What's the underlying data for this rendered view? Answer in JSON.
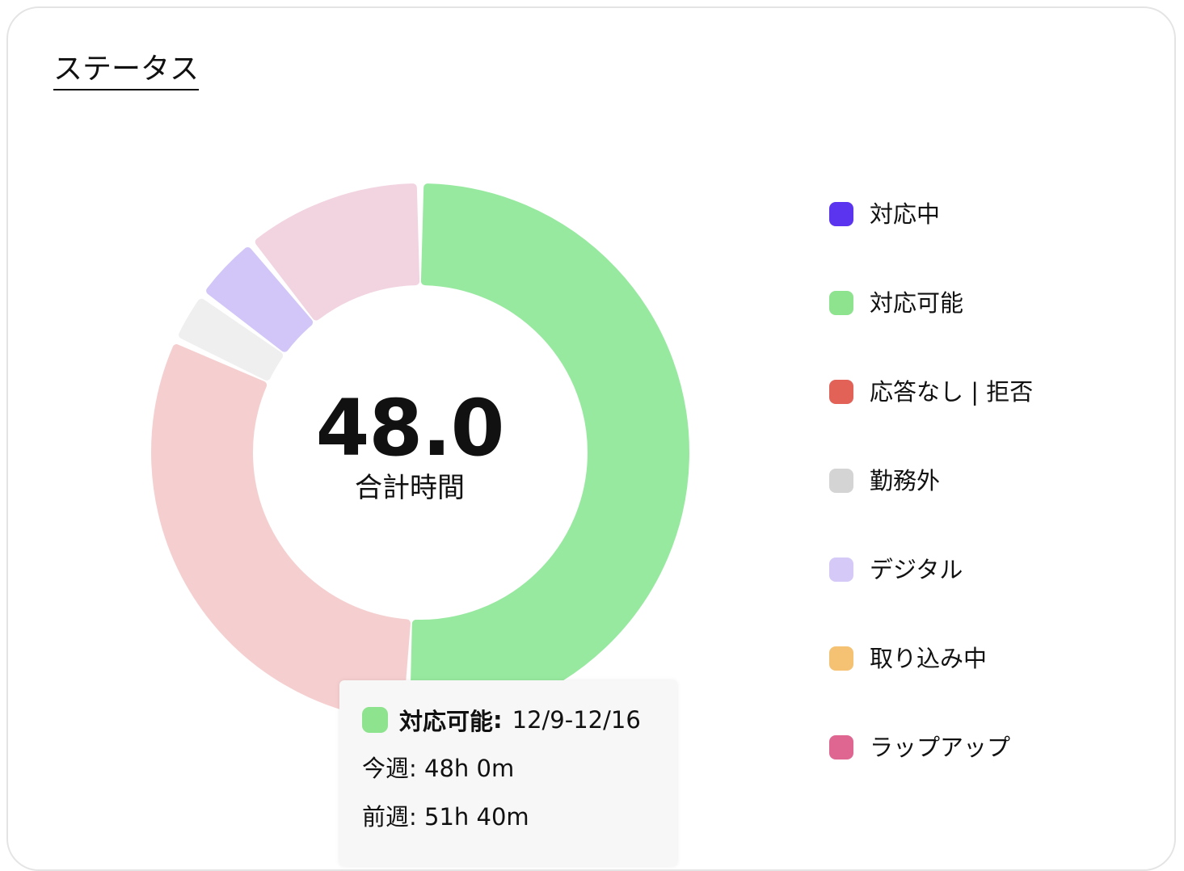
{
  "card": {
    "title": "ステータス"
  },
  "chart_data": {
    "type": "pie",
    "variant": "donut",
    "center": {
      "value": "48.0",
      "label": "合計時間"
    },
    "series": [
      {
        "name": "対応中",
        "value": 0,
        "color": "#5b34f0",
        "display_color": "#5b34f0"
      },
      {
        "name": "対応可能",
        "value": 24.4,
        "color": "#8ee38e",
        "display_color": "#97e99f"
      },
      {
        "name": "応答なし | 拒否",
        "value": 14.9,
        "color": "#e26258",
        "display_color": "#f5cfcf"
      },
      {
        "name": "勤務外",
        "value": 1.5,
        "color": "#d4d4d4",
        "display_color": "#efefef"
      },
      {
        "name": "デジタル",
        "value": 2.0,
        "color": "#d5c9f8",
        "display_color": "#d2c6f8"
      },
      {
        "name": "取り込み中",
        "value": 0,
        "color": "#f4c272",
        "display_color": "#f4c272"
      },
      {
        "name": "ラップアップ",
        "value": 5.2,
        "color": "#de6691",
        "display_color": "#f2d3e0"
      }
    ],
    "legend_position": "right",
    "highlighted": "対応可能"
  },
  "tooltip": {
    "series": "対応可能",
    "colon": ":",
    "range": "12/9-12/16",
    "this_week_label": "今週:",
    "this_week_value": "48h 0m",
    "last_week_label": "前週:",
    "last_week_value": "51h 40m",
    "color": "#8ee38e"
  }
}
